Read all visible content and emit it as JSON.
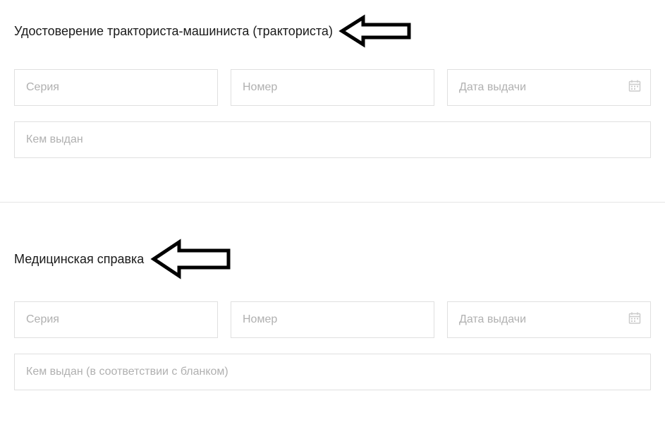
{
  "section1": {
    "title": "Удостоверение тракториста-машиниста (тракториста)",
    "series_placeholder": "Серия",
    "number_placeholder": "Номер",
    "date_placeholder": "Дата выдачи",
    "issued_by_placeholder": "Кем выдан"
  },
  "section2": {
    "title": "Медицинская справка",
    "series_placeholder": "Серия",
    "number_placeholder": "Номер",
    "date_placeholder": "Дата выдачи",
    "issued_by_placeholder": "Кем выдан (в соответствии с бланком)"
  }
}
